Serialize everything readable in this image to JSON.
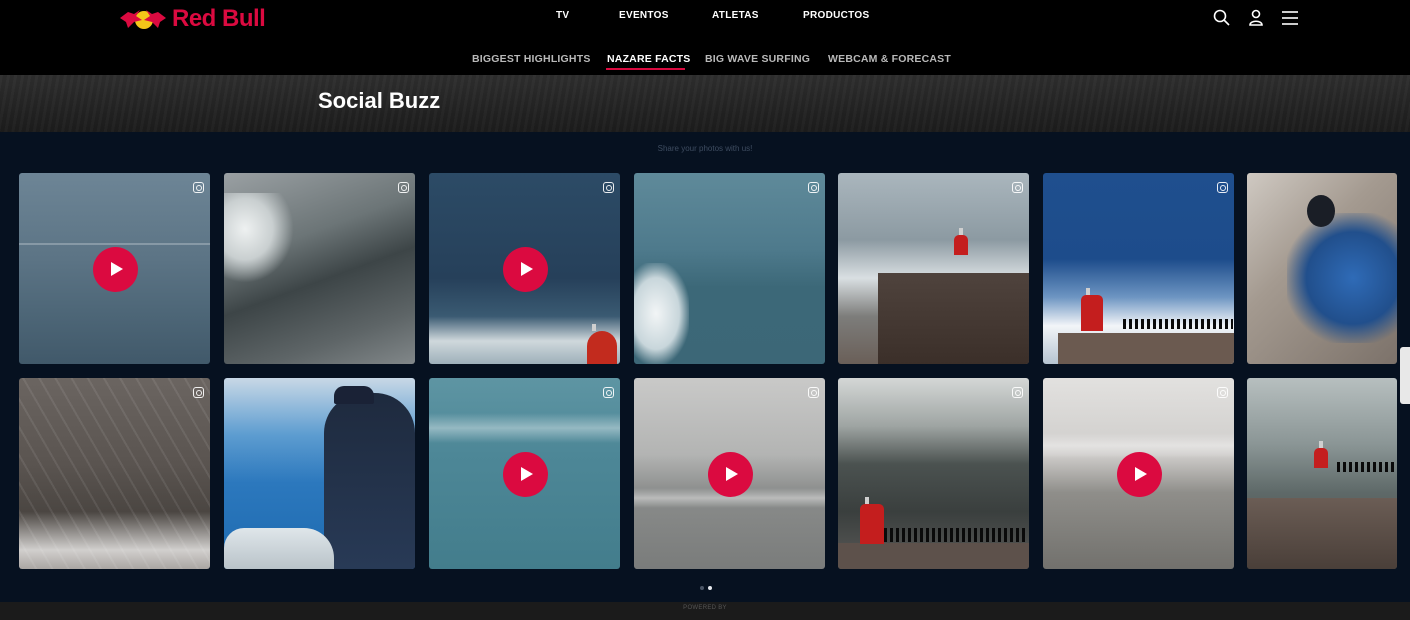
{
  "brand": {
    "name": "Red Bull",
    "color": "#db0a40"
  },
  "main_nav": [
    "TV",
    "EVENTOS",
    "ATLETAS",
    "PRODUCTOS"
  ],
  "header_icons": [
    "search-icon",
    "user-icon",
    "menu-icon"
  ],
  "sub_nav": {
    "items": [
      "BIGGEST HIGHLIGHTS",
      "NAZARE FACTS",
      "BIG WAVE SURFING",
      "WEBCAM & FORECAST"
    ],
    "active": "NAZARE FACTS"
  },
  "section": {
    "title": "Social Buzz",
    "caption": "Share your photos with us!"
  },
  "gallery": {
    "source_icon": "instagram-icon",
    "rows": [
      [
        {
          "scene": "wave-rider-calm",
          "video": true
        },
        {
          "scene": "breaking-wave-surfer",
          "video": false
        },
        {
          "scene": "big-wave-lighthouse",
          "video": true
        },
        {
          "scene": "jetski-wave",
          "video": false
        },
        {
          "scene": "fort-cliff-wave",
          "video": false
        },
        {
          "scene": "aerial-lighthouse-crowd",
          "video": false
        },
        {
          "scene": "surfer-closeup",
          "video": false
        }
      ],
      [
        {
          "scene": "giant-wave-face",
          "video": false
        },
        {
          "scene": "surfer-on-boat",
          "video": false
        },
        {
          "scene": "teal-ocean",
          "video": true
        },
        {
          "scene": "grey-sea",
          "video": true
        },
        {
          "scene": "lighthouse-crowd-storm",
          "video": false
        },
        {
          "scene": "misty-sea-jetski",
          "video": true
        },
        {
          "scene": "fort-lighthouse-mist",
          "video": false
        }
      ]
    ],
    "pagination": {
      "pages": 2,
      "active": 2
    }
  },
  "footer": {
    "powered_by": "POWERED BY"
  },
  "colors": {
    "accent": "#db0a40",
    "panel": "#061120",
    "header": "#000000"
  }
}
